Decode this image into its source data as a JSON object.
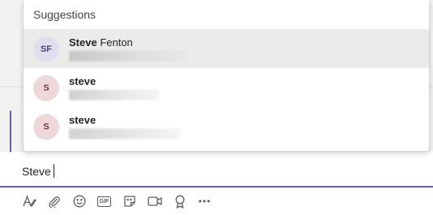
{
  "suggestions": {
    "header": "Suggestions",
    "items": [
      {
        "initials": "SF",
        "name_bold": "Steve",
        "name_rest": " Fenton",
        "avatar_color": "#e1dfef",
        "selected": true
      },
      {
        "initials": "S",
        "name_bold": "steve",
        "name_rest": "",
        "avatar_color": "#efd6d8",
        "selected": false
      },
      {
        "initials": "S",
        "name_bold": "steve",
        "name_rest": "",
        "avatar_color": "#efd6d8",
        "selected": false
      }
    ]
  },
  "compose": {
    "value": "Steve"
  },
  "toolbar": {
    "icons": [
      "format-icon",
      "attach-icon",
      "emoji-icon",
      "gif-icon",
      "sticker-icon",
      "meet-now-icon",
      "praise-icon",
      "more-options-icon"
    ],
    "gif_label": "GIF",
    "more_label": "•••"
  },
  "colors": {
    "accent": "#6264a7",
    "selected_row": "#edebe9"
  }
}
